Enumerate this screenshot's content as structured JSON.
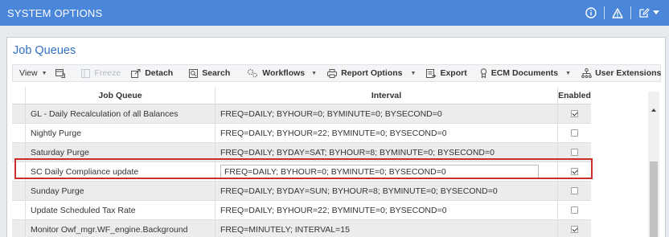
{
  "header": {
    "title": "SYSTEM OPTIONS",
    "icons": [
      "info-icon",
      "warning-icon",
      "edit-icon",
      "dropdown-icon"
    ]
  },
  "panel": {
    "title": "Job Queues"
  },
  "toolbar": {
    "view": "View",
    "freeze": "Freeze",
    "detach": "Detach",
    "search": "Search",
    "workflows": "Workflows",
    "report_options": "Report Options",
    "export": "Export",
    "ecm_documents": "ECM Documents",
    "user_extensions": "User Extensions"
  },
  "grid": {
    "columns": [
      "Job Queue",
      "Interval",
      "Enabled"
    ],
    "rows": [
      {
        "job_queue": "GL - Daily Recalculation of all Balances",
        "interval": "FREQ=DAILY; BYHOUR=0; BYMINUTE=0; BYSECOND=0",
        "enabled": true
      },
      {
        "job_queue": "Nightly Purge",
        "interval": "FREQ=DAILY; BYHOUR=22; BYMINUTE=0; BYSECOND=0",
        "enabled": false
      },
      {
        "job_queue": "Saturday Purge",
        "interval": "FREQ=DAILY; BYDAY=SAT; BYHOUR=8; BYMINUTE=0; BYSECOND=0",
        "enabled": false
      },
      {
        "job_queue": "SC Daily Compliance update",
        "interval": "FREQ=DAILY; BYHOUR=0; BYMINUTE=0; BYSECOND=0",
        "enabled": true
      },
      {
        "job_queue": "Sunday Purge",
        "interval": "FREQ=DAILY; BYDAY=SUN; BYHOUR=8; BYMINUTE=0; BYSECOND=0",
        "enabled": false
      },
      {
        "job_queue": "Update Scheduled Tax Rate",
        "interval": "FREQ=DAILY; BYHOUR=22; BYMINUTE=0; BYSECOND=0",
        "enabled": false
      },
      {
        "job_queue": "Monitor Owf_mgr.WF_engine.Background",
        "interval": "FREQ=MINUTELY; INTERVAL=15",
        "enabled": true
      }
    ],
    "selected_row": 3
  },
  "colors": {
    "title_bar": "#4a86d9",
    "accent": "#2f6fc4",
    "selection_border": "#c9302c"
  }
}
